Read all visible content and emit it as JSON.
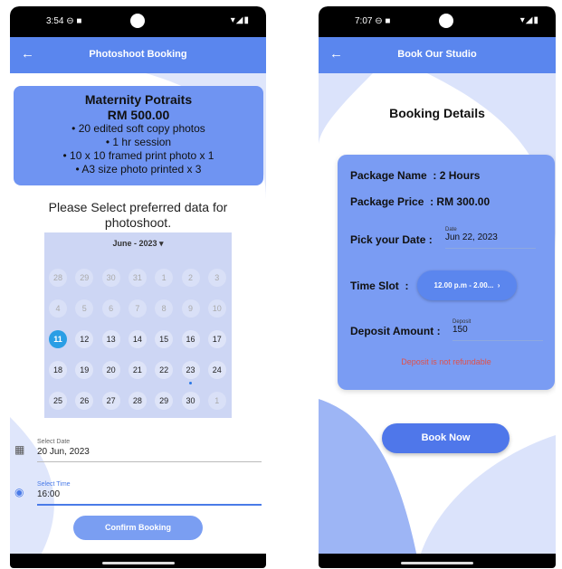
{
  "screen1": {
    "status": {
      "time": "3:54",
      "icons": "⊖ ■",
      "signal": "▾◢▮"
    },
    "appbar": {
      "title": "Photoshoot Booking",
      "back_icon": "arrow-left-icon"
    },
    "package": {
      "title": "Maternity Potraits",
      "price": "RM 500.00",
      "items": [
        "• 20 edited soft copy photos",
        "• 1 hr session",
        "• 10 x 10 framed print photo x 1",
        "• A3 size photo printed x 3"
      ]
    },
    "prompt": "Please Select preferred data for photoshoot.",
    "calendar": {
      "header": "June - 2023 ▾",
      "rows": [
        [
          "28",
          "29",
          "30",
          "31",
          "1",
          "2",
          "3"
        ],
        [
          "4",
          "5",
          "6",
          "7",
          "8",
          "9",
          "10"
        ],
        [
          "11",
          "12",
          "13",
          "14",
          "15",
          "16",
          "17"
        ],
        [
          "18",
          "19",
          "20",
          "21",
          "22",
          "23",
          "24"
        ],
        [
          "25",
          "26",
          "27",
          "28",
          "29",
          "30",
          "1"
        ]
      ],
      "selected": "11",
      "today": "23"
    },
    "date_field": {
      "label": "Select Date",
      "value": "20 Jun, 2023"
    },
    "time_field": {
      "label": "Select Time",
      "value": "16:00"
    },
    "confirm_label": "Confirm Booking",
    "colors": {
      "appbar": "#5a86ee",
      "card": "#6f94f2",
      "selected_day": "#2a9ee5"
    }
  },
  "screen2": {
    "status": {
      "time": "7:07",
      "icons": "⊖ ■",
      "signal": "▾◢▮"
    },
    "appbar": {
      "title": "Book Our Studio",
      "back_icon": "arrow-left-icon"
    },
    "heading": "Booking Details",
    "package_name": {
      "label": "Package Name",
      "sep": ":",
      "value": "2 Hours"
    },
    "package_price": {
      "label": "Package Price",
      "sep": ":",
      "value": "RM 300.00"
    },
    "pick_date": {
      "label": "Pick your Date",
      "sep": ":",
      "field_label": "Date",
      "value": "Jun 22, 2023"
    },
    "time_slot": {
      "label": "Time Slot",
      "sep": ":",
      "value": "12.00 p.m - 2.00...",
      "chevron": "›"
    },
    "deposit": {
      "label": "Deposit Amount",
      "sep": ":",
      "field_label": "Deposit",
      "value": "150"
    },
    "warning": "Deposit is not refundable",
    "book_label": "Book Now",
    "colors": {
      "card": "#7a9cf3",
      "button": "#4f77ea",
      "warning": "#e0504a"
    }
  }
}
